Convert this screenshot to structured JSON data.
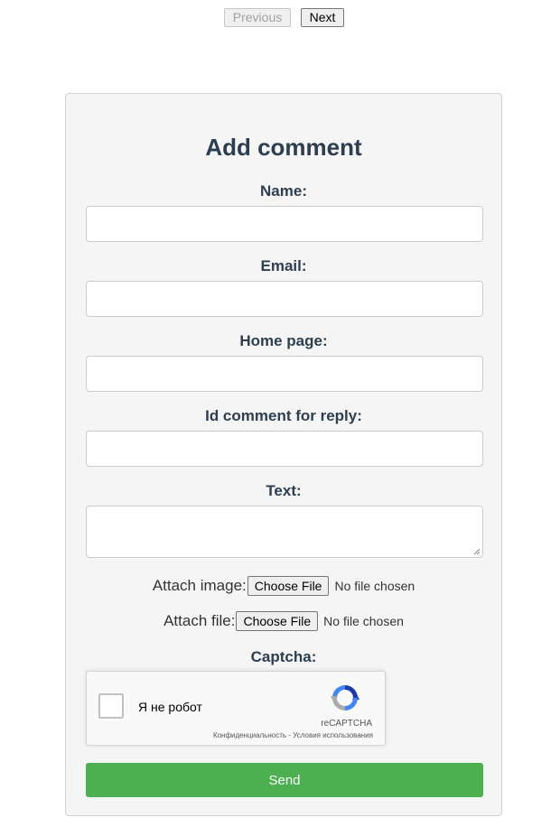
{
  "pager": {
    "previous_label": "Previous",
    "next_label": "Next"
  },
  "form": {
    "title": "Add comment",
    "name_label": "Name:",
    "name_value": "",
    "email_label": "Email:",
    "email_value": "",
    "homepage_label": "Home page:",
    "homepage_value": "",
    "reply_label": "Id comment for reply:",
    "reply_value": "",
    "text_label": "Text:",
    "text_value": "",
    "attach_image_label": "Attach image:",
    "attach_file_label": "Attach file:",
    "choose_file_label": "Choose File",
    "no_file_text": "No file chosen",
    "captcha_label": "Captcha:",
    "send_label": "Send"
  },
  "recaptcha": {
    "checkbox_text": "Я не робот",
    "brand": "reCAPTCHA",
    "privacy_link": "Конфиденциальность",
    "separator": " - ",
    "terms_link": "Условия использования"
  },
  "colors": {
    "send_button": "#4caf50",
    "title_text": "#2c3e50",
    "card_background": "#f5f5f5"
  },
  "icons": {
    "recaptcha_logo": "recaptcha-logo-icon",
    "resize_grip": "resize-grip-icon"
  }
}
